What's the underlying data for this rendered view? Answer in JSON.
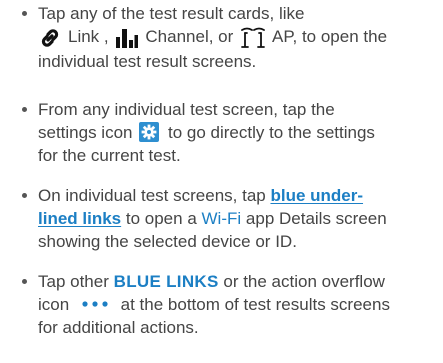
{
  "items": [
    {
      "lines": [
        "Tap any of the test result cards, like",
        {
          "link_label": "Link",
          "after_link": ",",
          "channel_label": "Channel, or",
          "ap_label": "AP, to open the"
        },
        "individual test result screens."
      ]
    },
    {
      "lines": [
        "From any individual test screen, tap the",
        {
          "before": "settings icon",
          "after": "to go directly to the settings"
        },
        "for the current test."
      ]
    },
    {
      "lines": [
        {
          "before": "On individual test screens, tap",
          "link1": "blue under-"
        },
        {
          "link2": "lined links",
          "after": "to open a",
          "wifi": "Wi-Fi",
          "after2": "app Details screen"
        },
        "showing the selected device or ID."
      ]
    },
    {
      "lines": [
        {
          "before": "Tap other",
          "link": "BLUE LINKS",
          "after": "or the action overflow"
        },
        {
          "before": "icon",
          "after": "at the bottom of test results screens"
        },
        "for additional actions."
      ]
    }
  ],
  "icons": {
    "link": "link-icon",
    "channel": "channel-bars-icon",
    "ap": "access-point-icon",
    "settings": "settings-gear-icon",
    "overflow": "overflow-dots-icon"
  },
  "colors": {
    "text": "#454545",
    "link": "#1c7fc4",
    "settings_icon_bg": "#2e8fd0"
  }
}
